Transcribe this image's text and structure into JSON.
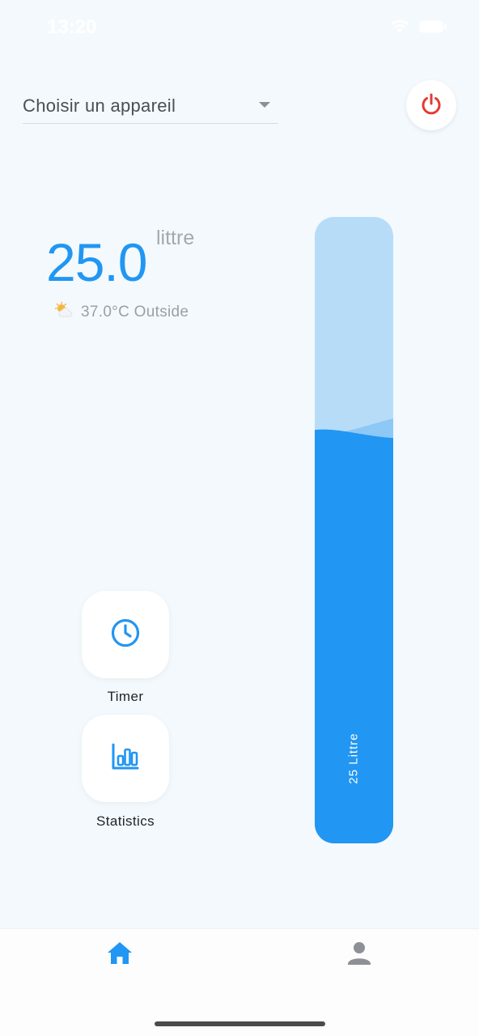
{
  "status_bar": {
    "time": "13:20"
  },
  "device_selector": {
    "label": "Choisir un appareil"
  },
  "reading": {
    "value": "25.0",
    "unit": "littre"
  },
  "weather": {
    "icon": "partly-sunny-icon",
    "text": "37.0°C Outside"
  },
  "actions": [
    {
      "label": "Timer",
      "icon": "clock-icon"
    },
    {
      "label": "Statistics",
      "icon": "bar-chart-icon"
    }
  ],
  "tank": {
    "label": "25 Littre",
    "fill_level_percent": 66
  },
  "bottom_nav": {
    "items": [
      {
        "icon": "home-icon",
        "active": true
      },
      {
        "icon": "person-icon",
        "active": false
      }
    ]
  },
  "colors": {
    "accent": "#2196f3",
    "tank_empty": "#b7dcf8",
    "power": "#e53935",
    "background": "#f3f9fd"
  }
}
